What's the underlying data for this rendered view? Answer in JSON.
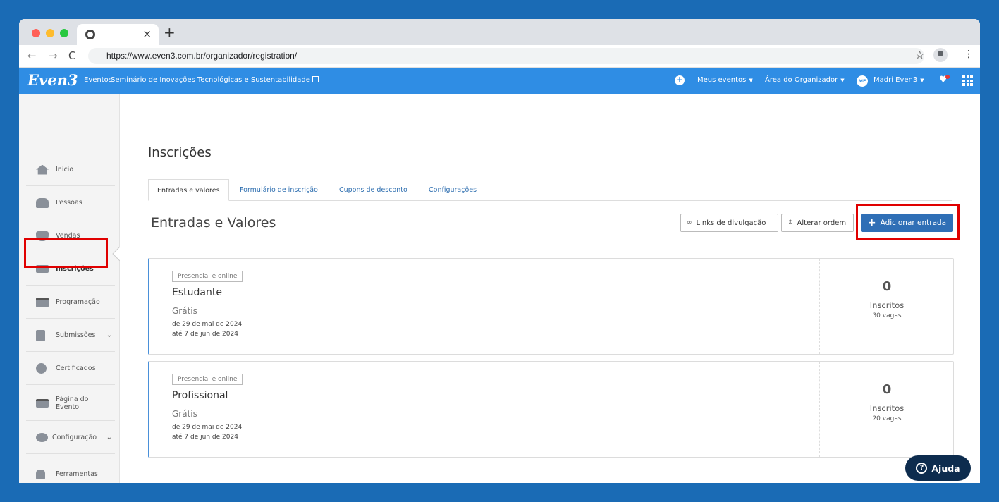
{
  "browser": {
    "tab_close": "×",
    "new_tab": "+",
    "url": "https://www.even3.com.br/organizador/registration/"
  },
  "header": {
    "logo": "Even3",
    "section": "Eventos",
    "event_name": "Seminário de Inovações Tecnológicas e Sustentabilidade",
    "my_events": "Meus eventos",
    "organizer_area": "Área do Organizador",
    "user_initials": "ME",
    "user_name": "Madri Even3"
  },
  "sidebar": {
    "items": [
      {
        "label": "Início",
        "icon": "home-icon"
      },
      {
        "label": "Pessoas",
        "icon": "people-icon"
      },
      {
        "label": "Vendas",
        "icon": "money-bag-icon"
      },
      {
        "label": "Inscrições",
        "icon": "ticket-icon"
      },
      {
        "label": "Programação",
        "icon": "calendar-icon"
      },
      {
        "label": "Submissões",
        "icon": "document-icon"
      },
      {
        "label": "Certificados",
        "icon": "certificate-icon"
      },
      {
        "label": "Página do Evento",
        "icon": "webpage-icon"
      },
      {
        "label": "Configuração",
        "icon": "settings-icon"
      },
      {
        "label": "Ferramentas",
        "icon": "lock-icon"
      }
    ]
  },
  "main": {
    "title": "Inscrições",
    "tabs": [
      {
        "label": "Entradas e valores"
      },
      {
        "label": "Formulário de inscrição"
      },
      {
        "label": "Cupons de desconto"
      },
      {
        "label": "Configurações"
      }
    ],
    "section_title": "Entradas e Valores",
    "buttons": {
      "links": "Links de divulgação",
      "reorder": "Alterar ordem",
      "add_entry": "Adicionar entrada"
    },
    "tickets": [
      {
        "badge": "Presencial e online",
        "name": "Estudante",
        "price": "Grátis",
        "from": "de 29 de mai de 2024",
        "to": "até 7 de jun de 2024",
        "count": "0",
        "count_label": "Inscritos",
        "vagas": "30 vagas"
      },
      {
        "badge": "Presencial e online",
        "name": "Profissional",
        "price": "Grátis",
        "from": "de 29 de mai de 2024",
        "to": "até 7 de jun de 2024",
        "count": "0",
        "count_label": "Inscritos",
        "vagas": "20 vagas"
      }
    ]
  },
  "help": {
    "label": "Ajuda"
  },
  "colors": {
    "background": "#1a6bb5",
    "header": "#2f8de4",
    "primary_button": "#2f6fb6",
    "highlight": "#e00000",
    "help_button": "#0d2c4e"
  }
}
